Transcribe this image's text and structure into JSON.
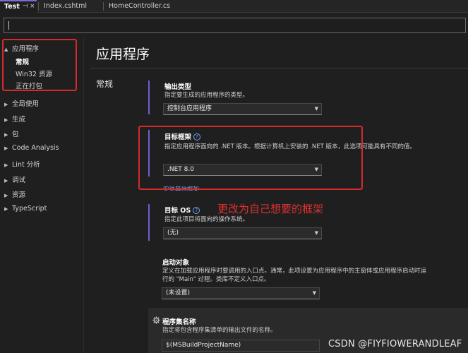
{
  "tabs": [
    {
      "label": "Test",
      "active": true,
      "pin_glyph": "⊣",
      "close_glyph": "×"
    },
    {
      "label": "Index.cshtml",
      "active": false
    },
    {
      "label": "HomeController.cs",
      "active": false
    }
  ],
  "search": {
    "value": ""
  },
  "sidebar": {
    "items": [
      {
        "label": "应用程序",
        "expanded": true
      },
      {
        "label": "全局使用"
      },
      {
        "label": "生成"
      },
      {
        "label": "包"
      },
      {
        "label": "Code Analysis"
      },
      {
        "label": "Lint 分析"
      },
      {
        "label": "调试"
      },
      {
        "label": "资源"
      },
      {
        "label": "TypeScript"
      }
    ],
    "subitems": [
      {
        "label": "常规",
        "selected": true
      },
      {
        "label": "Win32 资源"
      },
      {
        "label": "正在打包"
      }
    ]
  },
  "main": {
    "page_title": "应用程序",
    "section": "常规",
    "output_type": {
      "title": "输出类型",
      "desc": "指定要生成的应用程序的类型。",
      "value": "控制台应用程序"
    },
    "target_framework": {
      "title": "目标框架",
      "desc": "指定应用程序面向的 .NET 版本。根据计算机上安装的 .NET 版本，此选项可能具有不同的值。",
      "value": ".NET 8.0",
      "link": "安装其他框架"
    },
    "target_os": {
      "title": "目标 OS",
      "desc": "指定此项目将面向的操作系统。",
      "value": "(无)"
    },
    "startup_object": {
      "title": "启动对象",
      "desc": "定义在加载应用程序时要调用的入口点。通常，此项设置为应用程序中的主窗体或应用程序启动时运行的 \"Main\" 过程。类库不定义入口点。",
      "value": "(未设置)"
    },
    "assembly_name": {
      "title": "程序集名称",
      "desc": "指定将包含程序集清单的输出文件的名称。",
      "value": "$(MSBuildProjectName)"
    }
  },
  "annotation_text": "更改为自己想要的框架",
  "watermark": "CSDN @FIYFIOWERANDLEAF",
  "colors": {
    "accent": "#6b5fd1",
    "annotation_red": "#d42a2a",
    "link": "#7aa8ff",
    "background": "#1f1f1f"
  }
}
